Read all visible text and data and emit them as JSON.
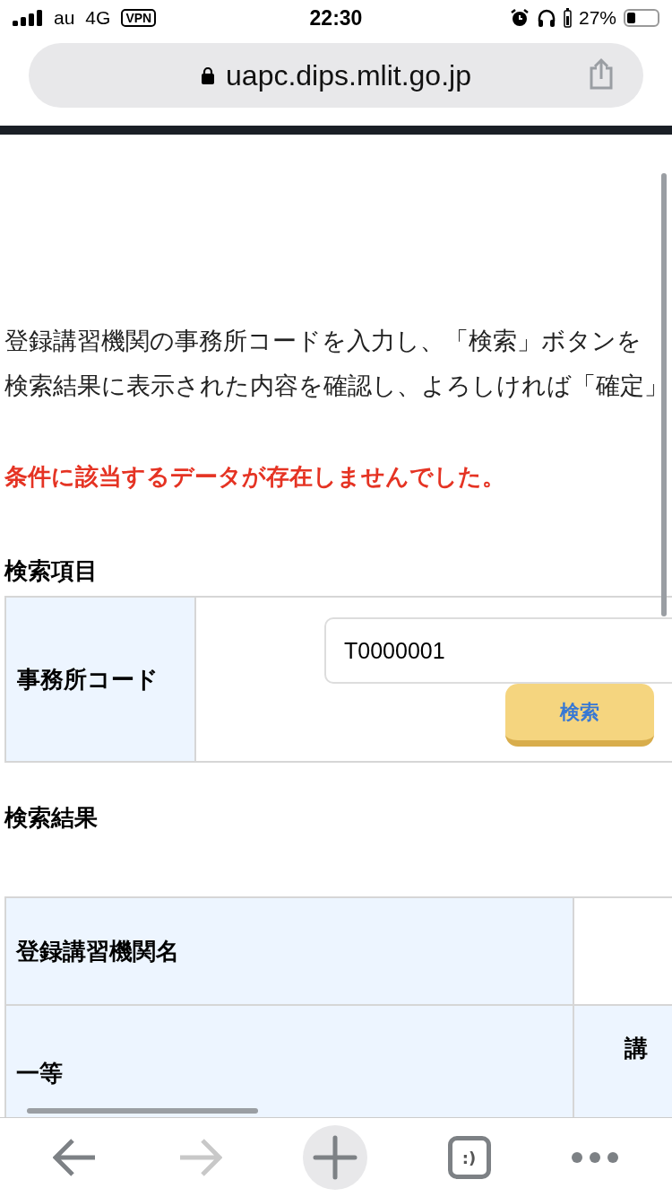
{
  "status_bar": {
    "carrier": "au",
    "network": "4G",
    "vpn": "VPN",
    "time": "22:30",
    "battery": "27%"
  },
  "address_bar": {
    "url": "uapc.dips.mlit.go.jp"
  },
  "instructions": [
    "登録講習機関の事務所コードを入力し、「検索」ボタンを",
    "検索結果に表示された内容を確認し、よろしければ「確定」"
  ],
  "error_message": "条件に該当するデータが存在しませんでした。",
  "search_section": {
    "heading": "検索項目",
    "field_label": "事務所コード",
    "field_value": "T0000001",
    "button": "検索"
  },
  "results_section": {
    "heading": "検索結果",
    "rows": [
      {
        "label": "登録講習機関名"
      },
      {
        "label": "一等",
        "sub_label": "講"
      }
    ]
  },
  "toolbar": {
    "back_disabled": false,
    "forward_disabled": true,
    "tabs_button": ":)"
  }
}
